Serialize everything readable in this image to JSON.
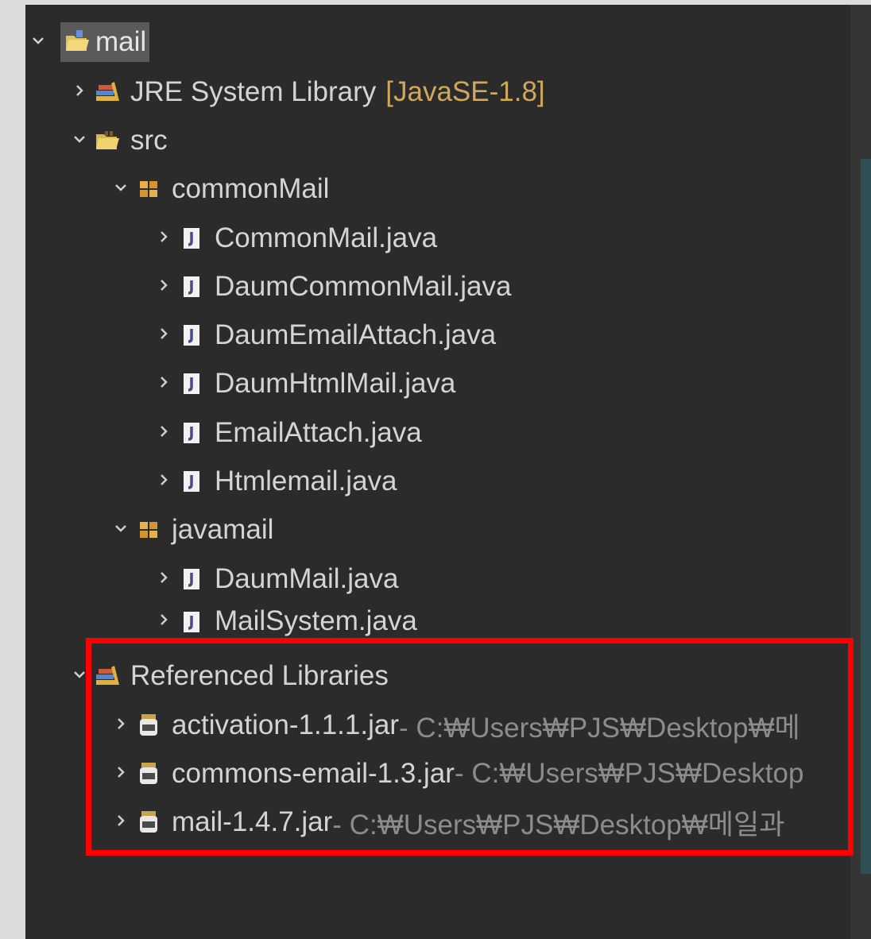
{
  "tree": {
    "project": {
      "label": "mail",
      "icon": "project-folder-icon"
    },
    "jre": {
      "label": "JRE System Library",
      "decoration": "[JavaSE-1.8]",
      "icon": "library-icon"
    },
    "src": {
      "label": "src",
      "icon": "source-folder-icon"
    },
    "packages": [
      {
        "label": "commonMail",
        "icon": "package-icon",
        "files": [
          "CommonMail.java",
          "DaumCommonMail.java",
          "DaumEmailAttach.java",
          "DaumHtmlMail.java",
          "EmailAttach.java",
          "Htmlemail.java"
        ]
      },
      {
        "label": "javamail",
        "icon": "package-icon",
        "files": [
          "DaumMail.java",
          "MailSystem.java"
        ]
      }
    ],
    "referenced": {
      "label": "Referenced Libraries",
      "icon": "library-icon",
      "jars": [
        {
          "name": "activation-1.1.1.jar",
          "path": " - C:₩Users₩PJS₩Desktop₩메"
        },
        {
          "name": "commons-email-1.3.jar",
          "path": " - C:₩Users₩PJS₩Desktop"
        },
        {
          "name": "mail-1.4.7.jar",
          "path": " - C:₩Users₩PJS₩Desktop₩메일과"
        }
      ]
    }
  },
  "colors": {
    "background": "#2b2b2b",
    "text": "#d4d4d4",
    "decoration": "#d0a85a",
    "path": "#8c8c8c",
    "highlight": "#ff0000",
    "selection": "#5a5a5a"
  }
}
